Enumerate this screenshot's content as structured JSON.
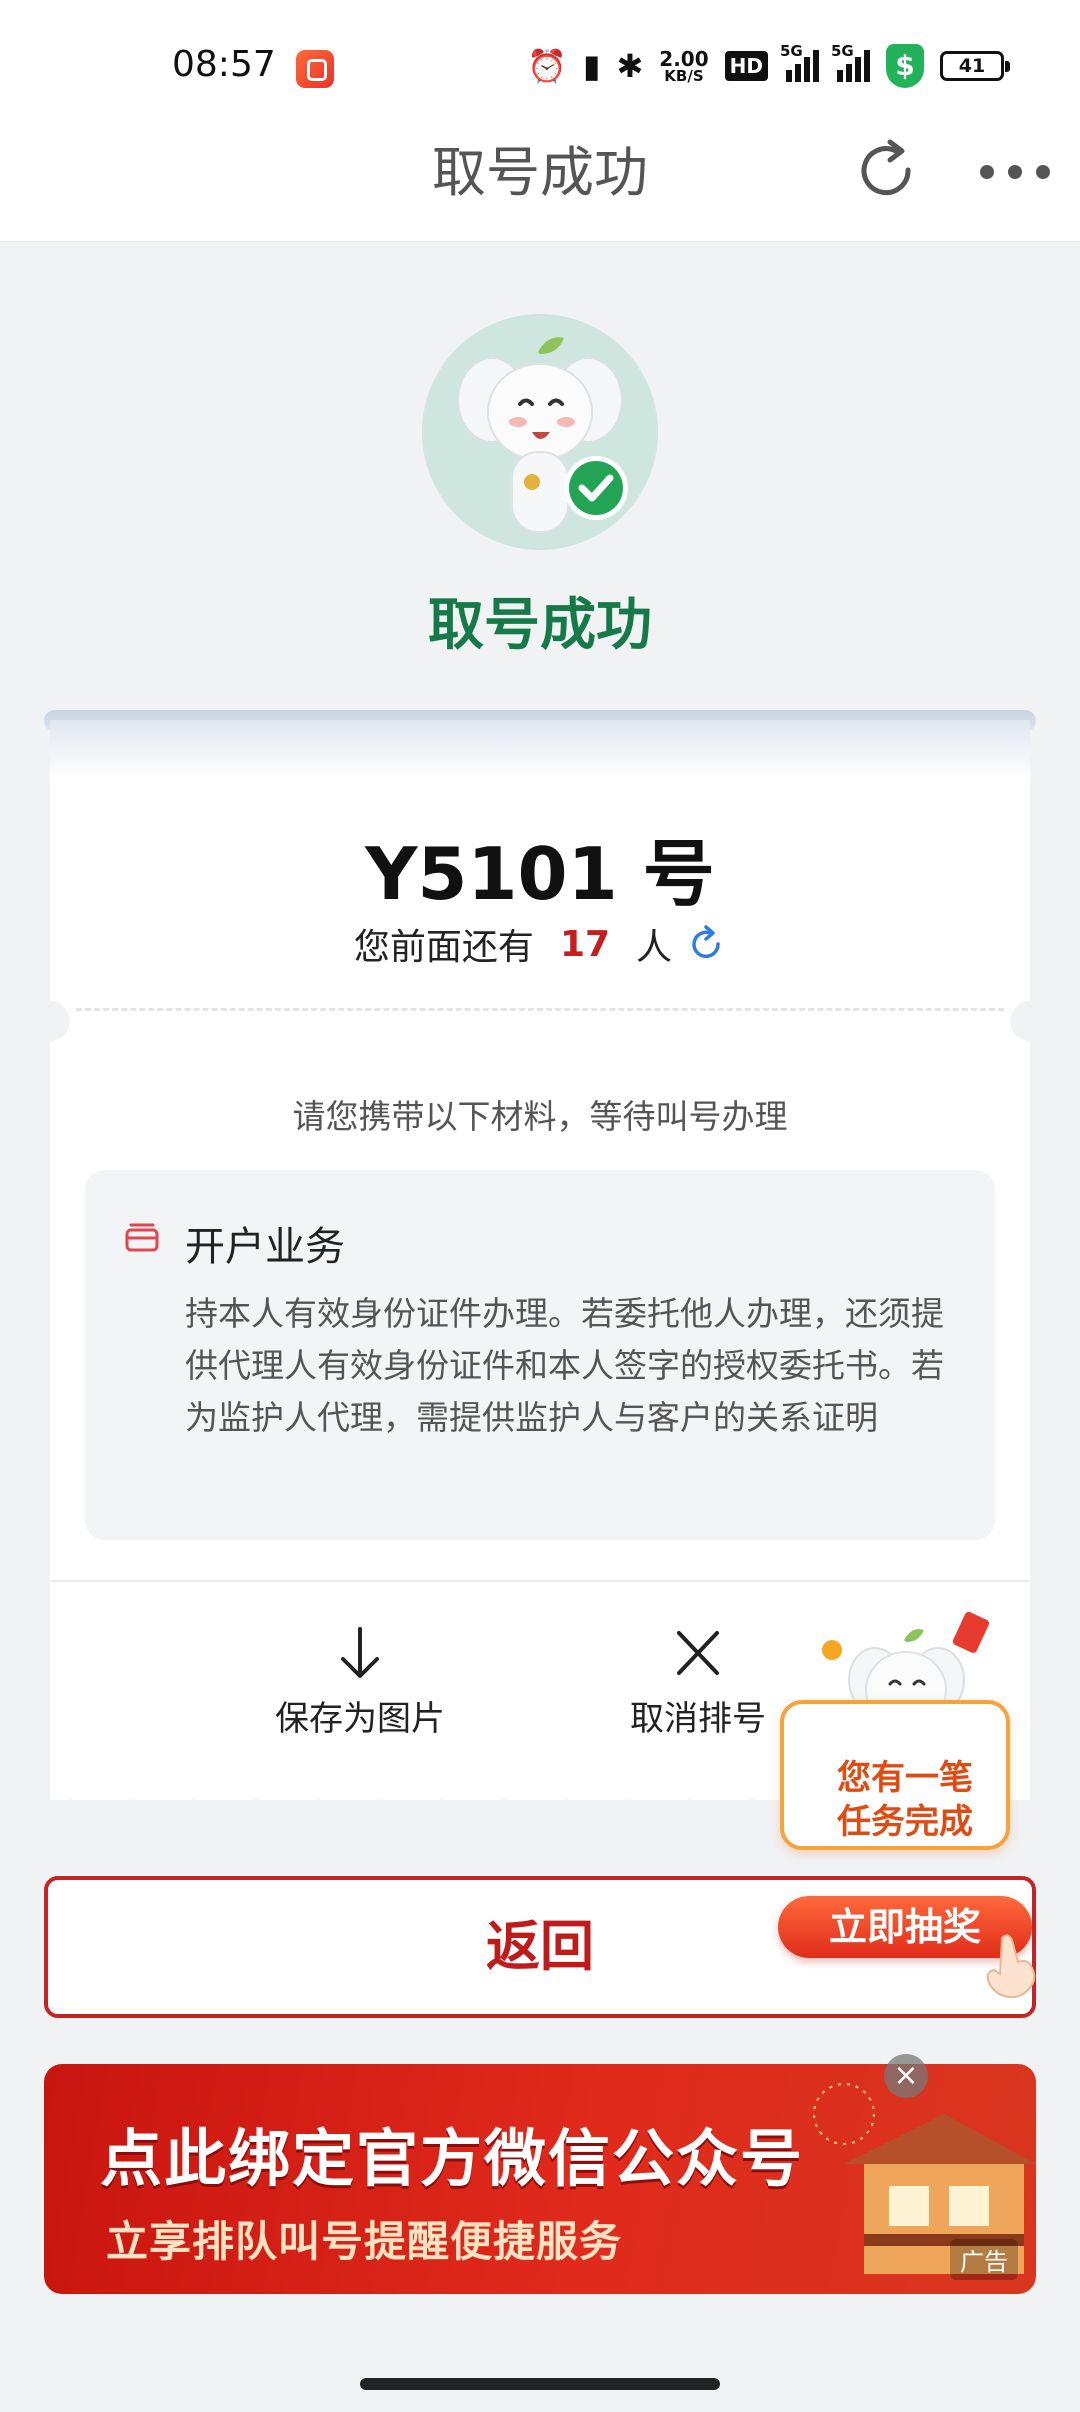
{
  "status_bar": {
    "time": "08:57",
    "net_rate": "2.00",
    "net_rate_unit": "KB/S",
    "hd": "HD",
    "signal1": "5G",
    "signal2": "5G",
    "battery": "41",
    "icons": [
      "app-notification-icon",
      "alarm-icon",
      "vibrate-icon",
      "bluetooth-icon",
      "hd-icon",
      "signal-icon",
      "shield-icon",
      "battery-icon"
    ]
  },
  "nav": {
    "title": "取号成功"
  },
  "success": {
    "title": "取号成功"
  },
  "ticket": {
    "number": "Y5101 号",
    "queue_prefix": "您前面还有",
    "queue_count": "17",
    "queue_suffix": "人",
    "bring_hint": "请您携带以下材料，等待叫号办理",
    "business": {
      "title": "开户业务",
      "description": "持本人有效身份证件办理。若委托他人办理，还须提供代理人有效身份证件和本人签字的授权委托书。若为监护人代理，需提供监护人与客户的关系证明"
    },
    "actions": {
      "save_label": "保存为图片",
      "cancel_label": "取消排号"
    }
  },
  "back_button": {
    "label": "返回"
  },
  "task_widget": {
    "line1": "您有一笔",
    "line2": "任务完成",
    "button": "立即抽奖"
  },
  "banner": {
    "line1": "点此绑定官方微信公众号",
    "line2": "立享排队叫号提醒便捷服务",
    "ad_tag": "广告"
  },
  "colors": {
    "accent_green": "#167a48",
    "accent_red": "#c01b1b",
    "count_red": "#c41e1e",
    "refresh_blue": "#2f7de1"
  }
}
